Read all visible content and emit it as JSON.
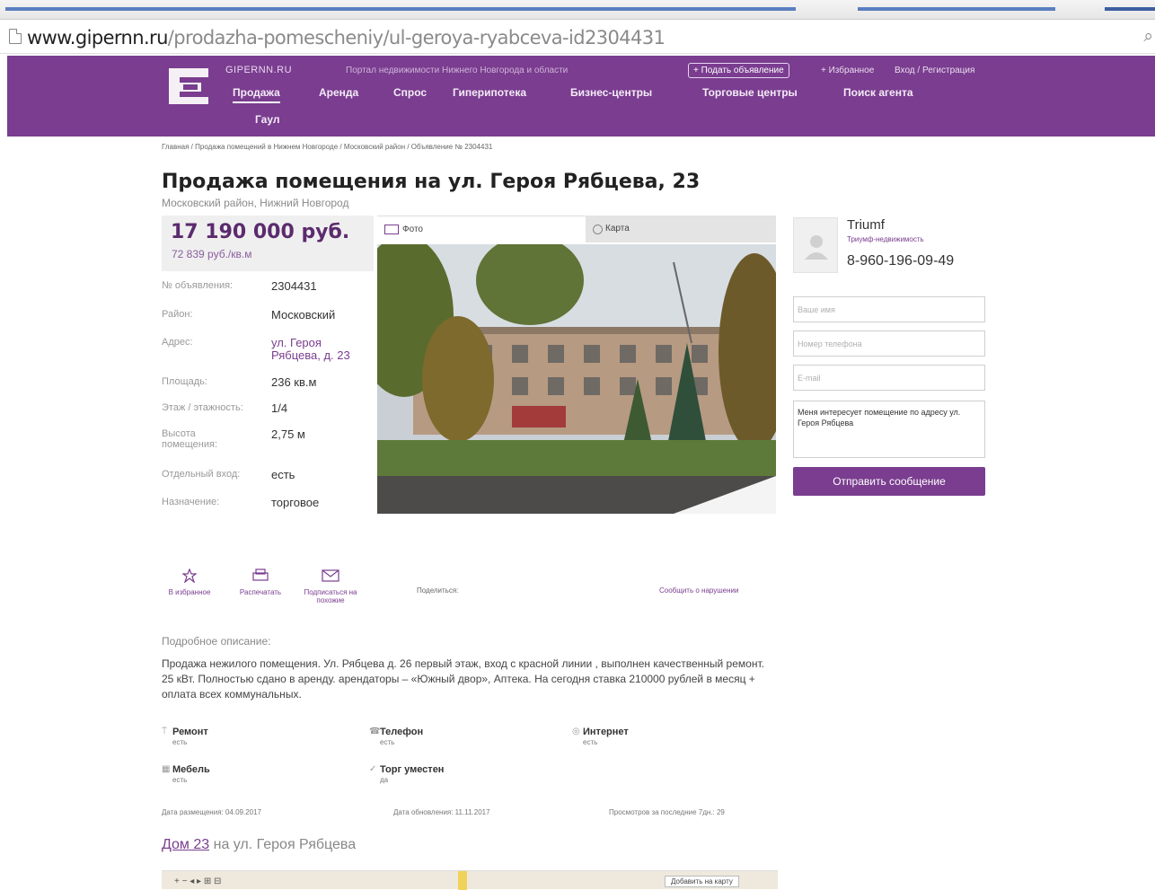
{
  "browser": {
    "url_host": "www.gipernn.ru",
    "url_path": "/prodazha-pomescheniy/ul-geroya-ryabceva-id2304431"
  },
  "header": {
    "site_name": "GIPERNN.RU",
    "tagline": "Портал недвижимости Нижнего Новгорода и области",
    "post_ad": "+ Подать объявление",
    "favorites": "+ Избранное",
    "login": "Вход / Регистрация",
    "nav": [
      "Продажа",
      "Аренда",
      "Спрос",
      "Гиперипотека",
      "Бизнес-центры",
      "Торговые центры",
      "Поиск агента",
      "Гаул"
    ],
    "accent": "#7a3d8f"
  },
  "breadcrumb": "Главная / Продажа помещений в Нижнем Новгороде / Московский район / Объявление № 2304431",
  "listing": {
    "title": "Продажа помещения на ул. Героя Рябцева, 23",
    "subtitle": "Московский район, Нижний Новгород",
    "price": "17 190 000 руб.",
    "price_per_m": "72 839 руб./кв.м",
    "specs": [
      {
        "key": "№ объявления:",
        "value": "2304431"
      },
      {
        "key": "Район:",
        "value": "Московский"
      },
      {
        "key": "Адрес:",
        "value": "ул. Героя Рябцева, д. 23"
      },
      {
        "key": "Площадь:",
        "value": "236 кв.м"
      },
      {
        "key": "Этаж / этажность:",
        "value": "1/4"
      },
      {
        "key": "Высота помещения:",
        "value": "2,75 м"
      },
      {
        "key": "Отдельный вход:",
        "value": "есть"
      },
      {
        "key": "Назначение:",
        "value": "торговое"
      }
    ]
  },
  "media": {
    "tab_photo": "Фото",
    "tab_map": "Карта"
  },
  "agent": {
    "name": "Triumf",
    "company": "Триумф-недвижимость",
    "phone": "8-960-196-09-49",
    "name_placeholder": "Ваше имя",
    "phone_placeholder": "Номер телефона",
    "email_placeholder": "E-mail",
    "message": "Меня интересует помещение по адресу ул. Героя Рябцева",
    "send_label": "Отправить сообщение"
  },
  "actions": {
    "favorite": "В избранное",
    "print": "Распечатать",
    "subscribe": "Подписаться на похожие",
    "share": "Поделиться:",
    "report": "Сообщить о нарушении"
  },
  "description": {
    "title": "Подробное описание:",
    "text": "Продажа нежилого помещения. Ул. Рябцева д. 26 первый этаж, вход с красной линии , выполнен качественный ремонт. 25 кВт. Полностью сдано в аренду. арендаторы – «Южный двор», Аптека. На сегодня ставка 210000 рублей в месяц + оплата всех коммунальных."
  },
  "features": [
    {
      "title": "Ремонт",
      "value": "есть",
      "icon": "brush-icon"
    },
    {
      "title": "Телефон",
      "value": "есть",
      "icon": "phone-icon"
    },
    {
      "title": "Интернет",
      "value": "есть",
      "icon": "internet-icon"
    },
    {
      "title": "Мебель",
      "value": "есть",
      "icon": "furniture-icon"
    },
    {
      "title": "Торг уместен",
      "value": "да",
      "icon": "check-icon"
    }
  ],
  "meta": {
    "posted": "Дата размещения: 04.09.2017",
    "updated": "Дата обновления: 11.11.2017",
    "views": "Просмотров за последние 7дн.: 29"
  },
  "house": {
    "link": "Дом 23",
    "rest": " на ул. Героя Рябцева"
  },
  "map": {
    "controls": "+ −  ◂ ▸  ⊞ ⊟",
    "layer_button": "Добавить на карту"
  }
}
